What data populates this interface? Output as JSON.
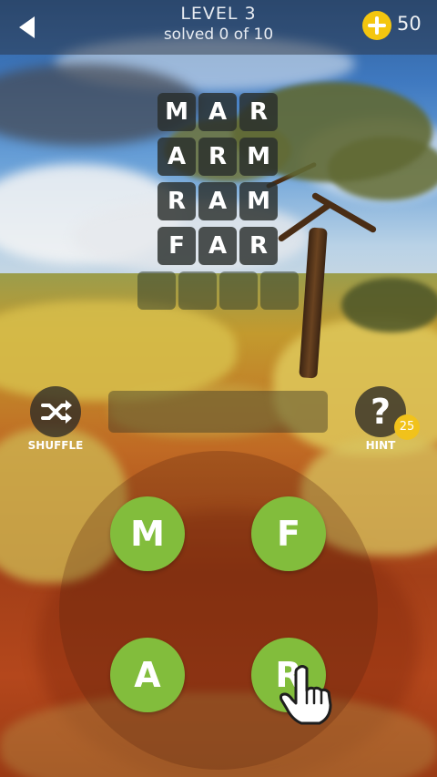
{
  "header": {
    "level_title": "LEVEL 3",
    "progress_text": "solved 0 of 10",
    "coins": "50"
  },
  "grid": {
    "rows": [
      [
        "M",
        "A",
        "R"
      ],
      [
        "A",
        "R",
        "M"
      ],
      [
        "R",
        "A",
        "M"
      ],
      [
        "F",
        "A",
        "R"
      ],
      [
        "",
        "",
        "",
        ""
      ]
    ]
  },
  "controls": {
    "shuffle_label": "SHUFFLE",
    "hint_label": "HINT",
    "hint_cost": "25",
    "current_word": ""
  },
  "wheel": {
    "letters": [
      "M",
      "F",
      "A",
      "R"
    ]
  },
  "colors": {
    "letter_bg": "#82bd3c",
    "coin": "#f4c60f",
    "tile_bg": "#2a2e2c"
  },
  "icons": [
    "back-arrow-icon",
    "coin-plus-icon",
    "shuffle-icon",
    "question-mark-icon",
    "pointing-hand-icon"
  ]
}
